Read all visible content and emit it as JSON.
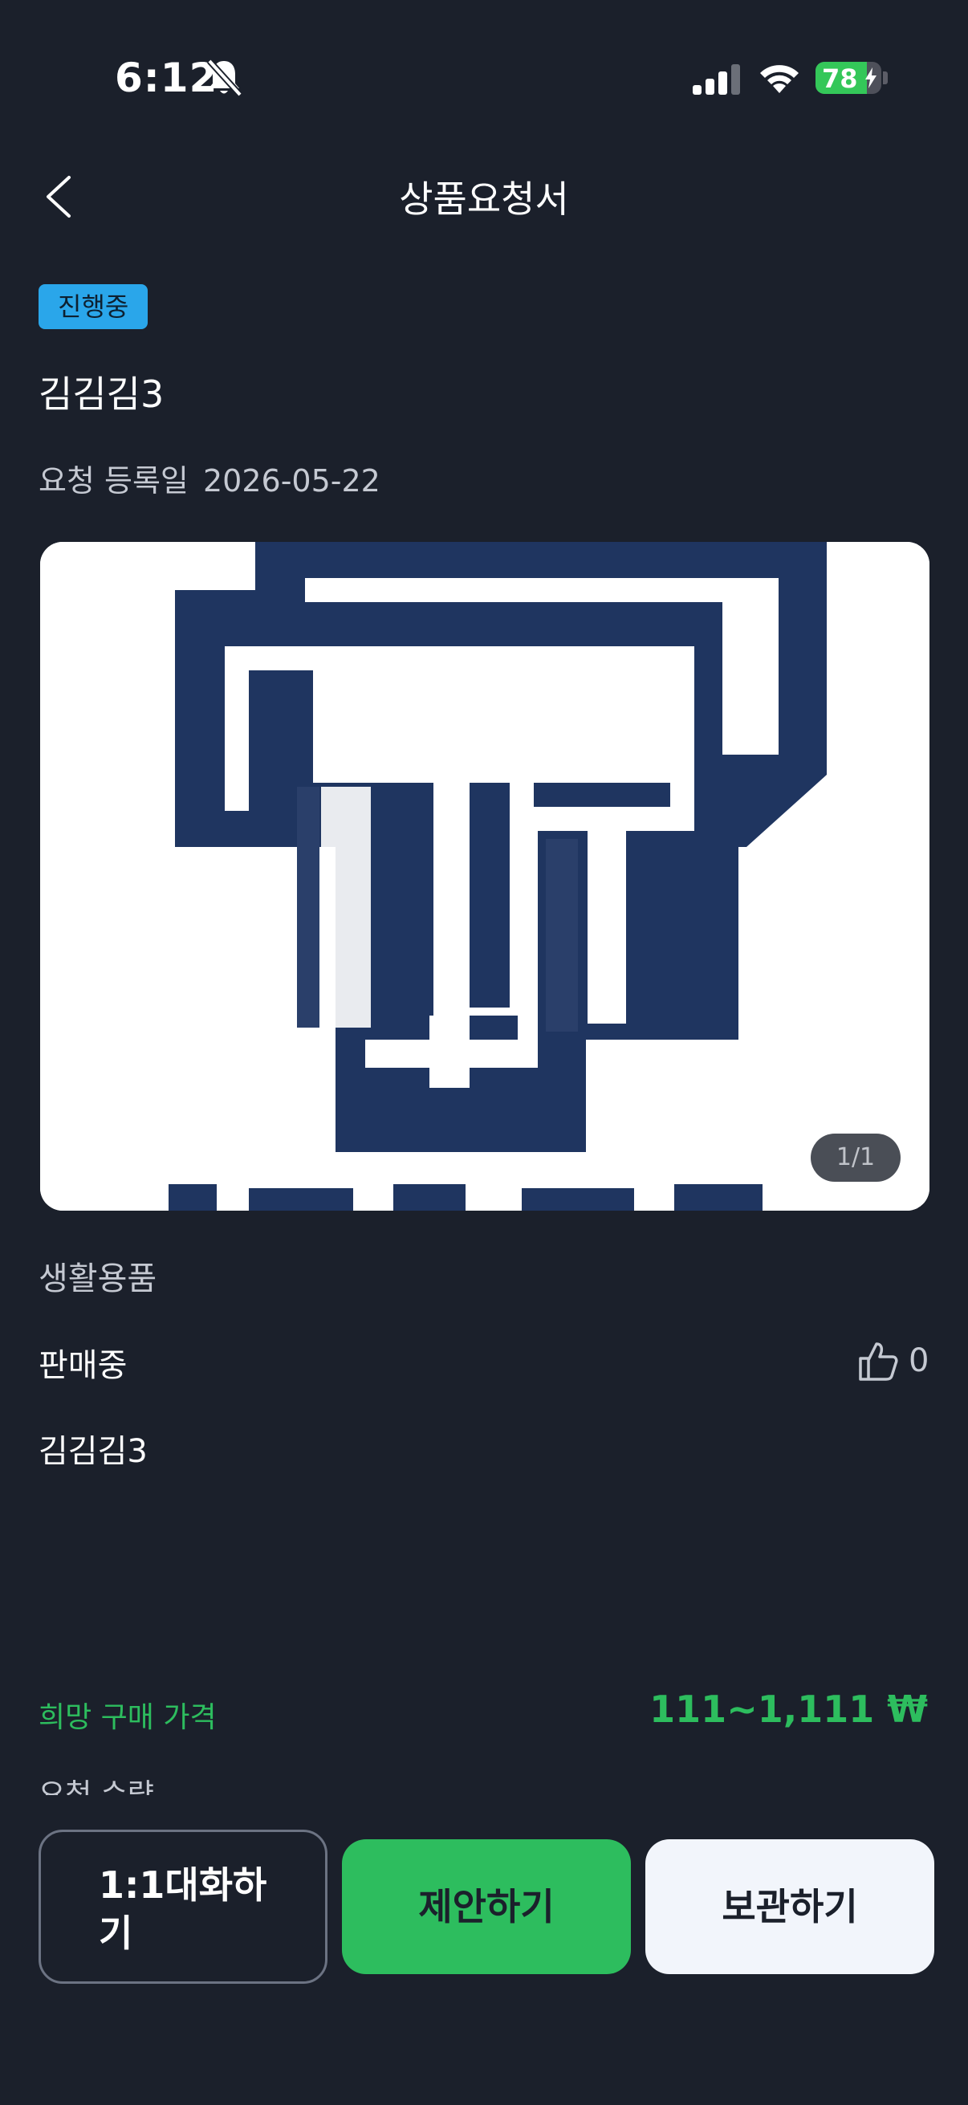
{
  "status_bar": {
    "time": "6:12",
    "battery": "78",
    "battery_level": 0.78
  },
  "header": {
    "title": "상품요청서"
  },
  "request": {
    "status_badge": "진행중",
    "title": "김김김3",
    "registered_label": "요청 등록일",
    "registered_date": "2026-05-22",
    "image_counter": "1/1",
    "category": "생활용품",
    "sale_status": "판매중",
    "like_count": "0",
    "description": "김김김3",
    "price_label": "희망 구매 가격",
    "price_value": "111~1,111 ₩",
    "quantity_label": "요청 수량"
  },
  "actions": {
    "chat_label": "1:1대화하기",
    "offer_label": "제안하기",
    "save_label": "보관하기"
  },
  "colors": {
    "background": "#1b202b",
    "accent_green": "#2dbd5e",
    "badge_blue": "#2aa6ea",
    "logo_navy": "#1f3560"
  },
  "icons": [
    "bell-slash-icon",
    "signal-icon",
    "wifi-icon",
    "battery-icon",
    "back-chevron-icon",
    "thumbs-up-icon"
  ]
}
